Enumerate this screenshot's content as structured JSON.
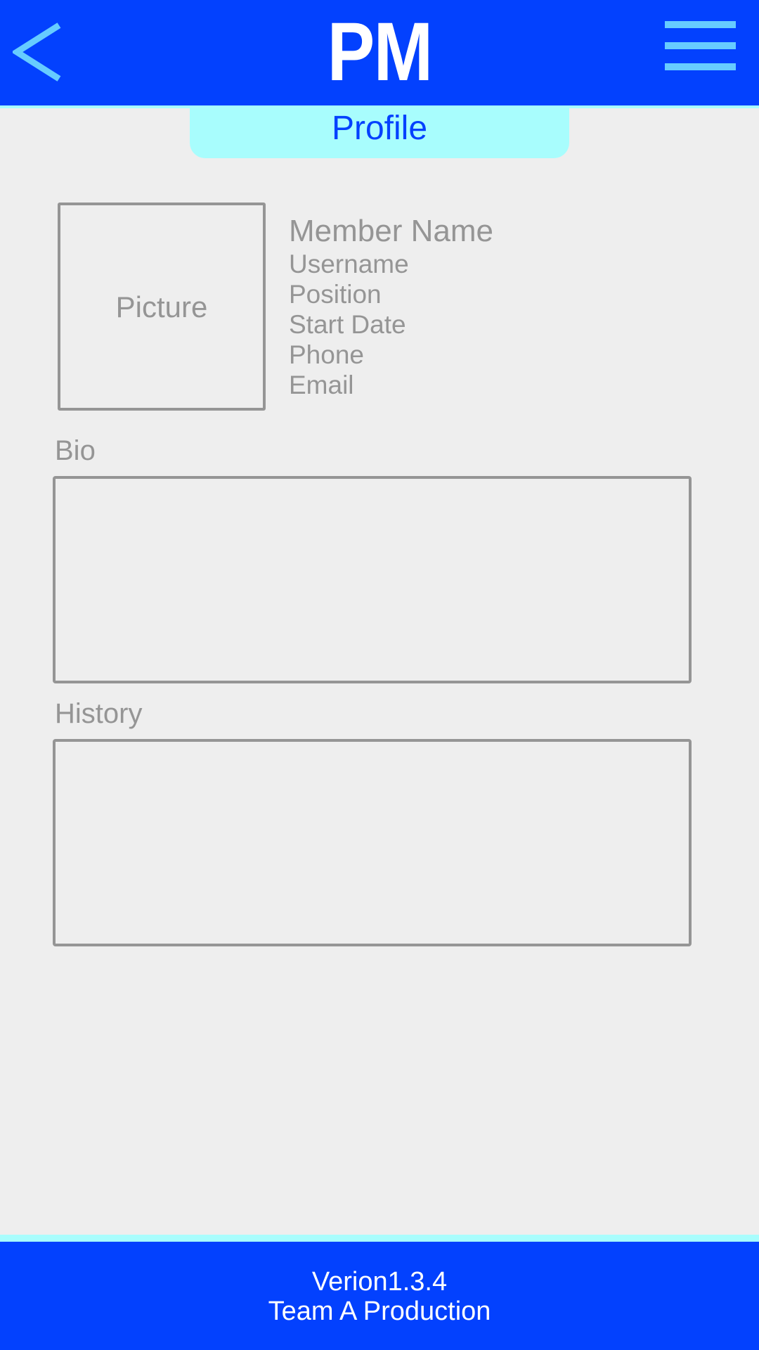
{
  "header": {
    "title": "PM",
    "background": "#0341fe",
    "accent": "#66ccff",
    "back_icon": "chevron-left-icon",
    "menu_icon": "hamburger-menu-icon"
  },
  "tab": {
    "label": "Profile",
    "background": "#a8fdfd"
  },
  "profile": {
    "picture_label": "Picture",
    "member_name": "Member Name",
    "fields": [
      "Username",
      "Position",
      "Start Date",
      "Phone",
      "Email"
    ]
  },
  "sections": {
    "bio_label": "Bio",
    "history_label": "History"
  },
  "footer": {
    "version": "Verion1.3.4",
    "team": "Team A Production"
  }
}
